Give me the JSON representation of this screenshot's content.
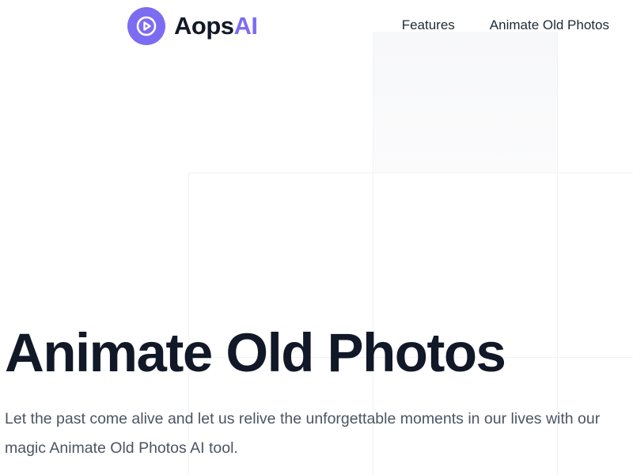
{
  "brand": {
    "name_main": "Aops",
    "name_accent": "AI",
    "icon": "play-icon",
    "accent_color": "#7c6cf2"
  },
  "nav": {
    "items": [
      {
        "label": "Features"
      },
      {
        "label": "Animate Old Photos"
      }
    ]
  },
  "hero": {
    "title": "Animate Old Photos",
    "subtitle": "Let the past come alive and let us relive the unforgettable moments in our lives with our magic Animate Old Photos AI tool."
  }
}
